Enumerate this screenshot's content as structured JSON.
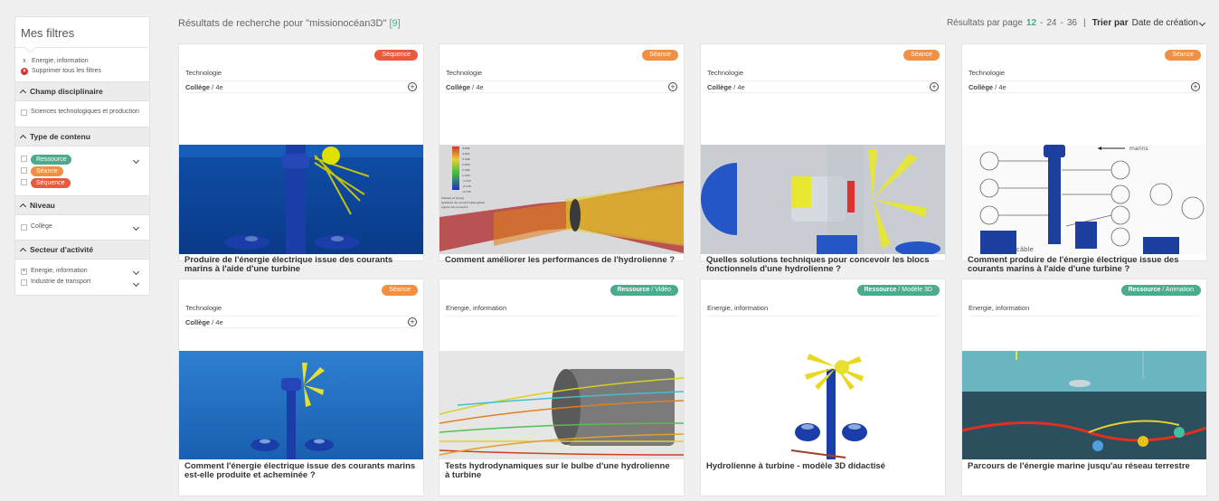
{
  "sidebar": {
    "title": "Mes filtres",
    "active_filters": [
      {
        "label": "Energie, information",
        "icon": "x-icon"
      }
    ],
    "clear_all": "Supprimer tous les filtres",
    "sections": {
      "champ": {
        "title": "Champ disciplinaire",
        "items": [
          "Sciences technologiques et production"
        ]
      },
      "type": {
        "title": "Type de contenu",
        "items": [
          "Ressource",
          "Séance",
          "Séquence"
        ]
      },
      "niveau": {
        "title": "Niveau",
        "items": [
          "Collège"
        ]
      },
      "secteur": {
        "title": "Secteur d'activité",
        "items": [
          "Energie, information",
          "Industrie de transport"
        ]
      }
    }
  },
  "header": {
    "results_prefix": "Résultats de recherche pour \"missionocéan3D\"",
    "results_count": "[9]",
    "per_page_label": "Résultats par page",
    "per_page_options": [
      "12",
      "24",
      "36"
    ],
    "sort_label": "Trier par",
    "sort_value": "Date de création"
  },
  "colors": {
    "ressource": "#4bab8e",
    "seance": "#f19042",
    "sequence": "#ea5b3e"
  },
  "cards": [
    {
      "badge": "Séquence",
      "badge_sub": "",
      "subject": "Technologie",
      "level_main": "Collège",
      "level_sub": "4e",
      "title": "Produire de l'énergie électrique issue des courants marins à l'aide d'une turbine"
    },
    {
      "badge": "Séance",
      "badge_sub": "",
      "subject": "Technologie",
      "level_main": "Collège",
      "level_sub": "4e",
      "title": "Comment améliorer les performances de l'hydrolienne ?"
    },
    {
      "badge": "Séance",
      "badge_sub": "",
      "subject": "Technologie",
      "level_main": "Collège",
      "level_sub": "4e",
      "title": "Quelles solutions techniques pour concevoir les blocs fonctionnels d'une hydrolienne ?"
    },
    {
      "badge": "Séance",
      "badge_sub": "",
      "subject": "Technologie",
      "level_main": "Collège",
      "level_sub": "4e",
      "title": "Comment produire de l'énergie électrique issue des courants marins à l'aide d'une turbine ?"
    },
    {
      "badge": "Séance",
      "badge_sub": "",
      "subject": "Technologie",
      "level_main": "Collège",
      "level_sub": "4e",
      "title": "Comment l'énergie électrique issue des courants marins est-elle produite et acheminée ?"
    },
    {
      "badge": "Ressource",
      "badge_sub": "Vidéo",
      "subject": "Energie, information",
      "level_main": "",
      "level_sub": "",
      "title": "Tests hydrodynamiques sur le bulbe d'une hydrolienne à turbine"
    },
    {
      "badge": "Ressource",
      "badge_sub": "Modèle 3D",
      "subject": "Energie, information",
      "level_main": "",
      "level_sub": "",
      "title": "Hydrolienne à turbine - modèle 3D didactisé"
    },
    {
      "badge": "Ressource",
      "badge_sub": "Animation",
      "subject": "Energie, information",
      "level_main": "",
      "level_sub": "",
      "title": "Parcours de l'énergie marine jusqu'au réseau terrestre"
    }
  ],
  "thumb_cfd_legend": [
    "4.656",
    "4.051",
    "3.346",
    "2.640",
    "1.934",
    "1.229",
    "-1.172",
    "-2.176",
    "-4.735",
    "Vitesse (2 [m/s])",
    "Système de coordonnées global",
    "Lignes de courant 1"
  ],
  "thumb_diagram_label": "marins",
  "thumb_diagram_cable": "câble"
}
